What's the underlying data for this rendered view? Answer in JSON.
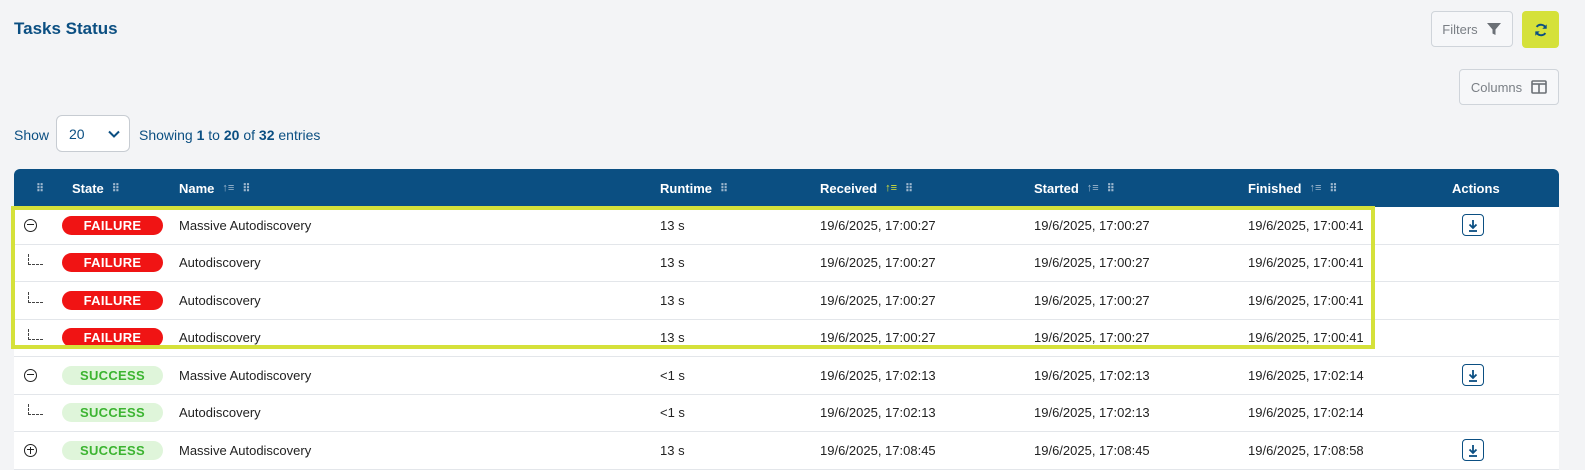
{
  "page": {
    "title": "Tasks Status"
  },
  "toolbar": {
    "filters_label": "Filters",
    "columns_label": "Columns"
  },
  "pagination": {
    "show_label": "Show",
    "page_size": "20",
    "showing_prefix": "Showing",
    "from": "1",
    "to_word": "to",
    "to": "20",
    "of_word": "of",
    "total": "32",
    "suffix": "entries"
  },
  "columns": {
    "state": "State",
    "name": "Name",
    "runtime": "Runtime",
    "received": "Received",
    "started": "Started",
    "finished": "Finished",
    "actions": "Actions"
  },
  "rows": [
    {
      "kind": "parent-expanded",
      "state": "FAILURE",
      "status": "failure",
      "name": "Massive Autodiscovery",
      "runtime": "13 s",
      "received": "19/6/2025, 17:00:27",
      "started": "19/6/2025, 17:00:27",
      "finished": "19/6/2025, 17:00:41",
      "action": true
    },
    {
      "kind": "child",
      "state": "FAILURE",
      "status": "failure",
      "name": "Autodiscovery",
      "runtime": "13 s",
      "received": "19/6/2025, 17:00:27",
      "started": "19/6/2025, 17:00:27",
      "finished": "19/6/2025, 17:00:41",
      "action": false
    },
    {
      "kind": "child",
      "state": "FAILURE",
      "status": "failure",
      "name": "Autodiscovery",
      "runtime": "13 s",
      "received": "19/6/2025, 17:00:27",
      "started": "19/6/2025, 17:00:27",
      "finished": "19/6/2025, 17:00:41",
      "action": false
    },
    {
      "kind": "child",
      "state": "FAILURE",
      "status": "failure",
      "name": "Autodiscovery",
      "runtime": "13 s",
      "received": "19/6/2025, 17:00:27",
      "started": "19/6/2025, 17:00:27",
      "finished": "19/6/2025, 17:00:41",
      "action": false
    },
    {
      "kind": "parent-expanded",
      "state": "SUCCESS",
      "status": "success",
      "name": "Massive Autodiscovery",
      "runtime": "<1 s",
      "received": "19/6/2025, 17:02:13",
      "started": "19/6/2025, 17:02:13",
      "finished": "19/6/2025, 17:02:14",
      "action": true
    },
    {
      "kind": "child",
      "state": "SUCCESS",
      "status": "success",
      "name": "Autodiscovery",
      "runtime": "<1 s",
      "received": "19/6/2025, 17:02:13",
      "started": "19/6/2025, 17:02:13",
      "finished": "19/6/2025, 17:02:14",
      "action": false
    },
    {
      "kind": "parent-collapsed",
      "state": "SUCCESS",
      "status": "success",
      "name": "Massive Autodiscovery",
      "runtime": "13 s",
      "received": "19/6/2025, 17:08:45",
      "started": "19/6/2025, 17:08:45",
      "finished": "19/6/2025, 17:08:58",
      "action": true
    }
  ],
  "colors": {
    "accent": "#d5e13a",
    "header": "#0b4f82",
    "failure": "#f01414",
    "success": "#3cb431"
  },
  "icons": {
    "filter": "funnel-icon",
    "refresh": "refresh-icon",
    "columns": "columns-icon",
    "download": "download-icon",
    "expand": "collapse-icon",
    "child": "child-branch-icon"
  }
}
